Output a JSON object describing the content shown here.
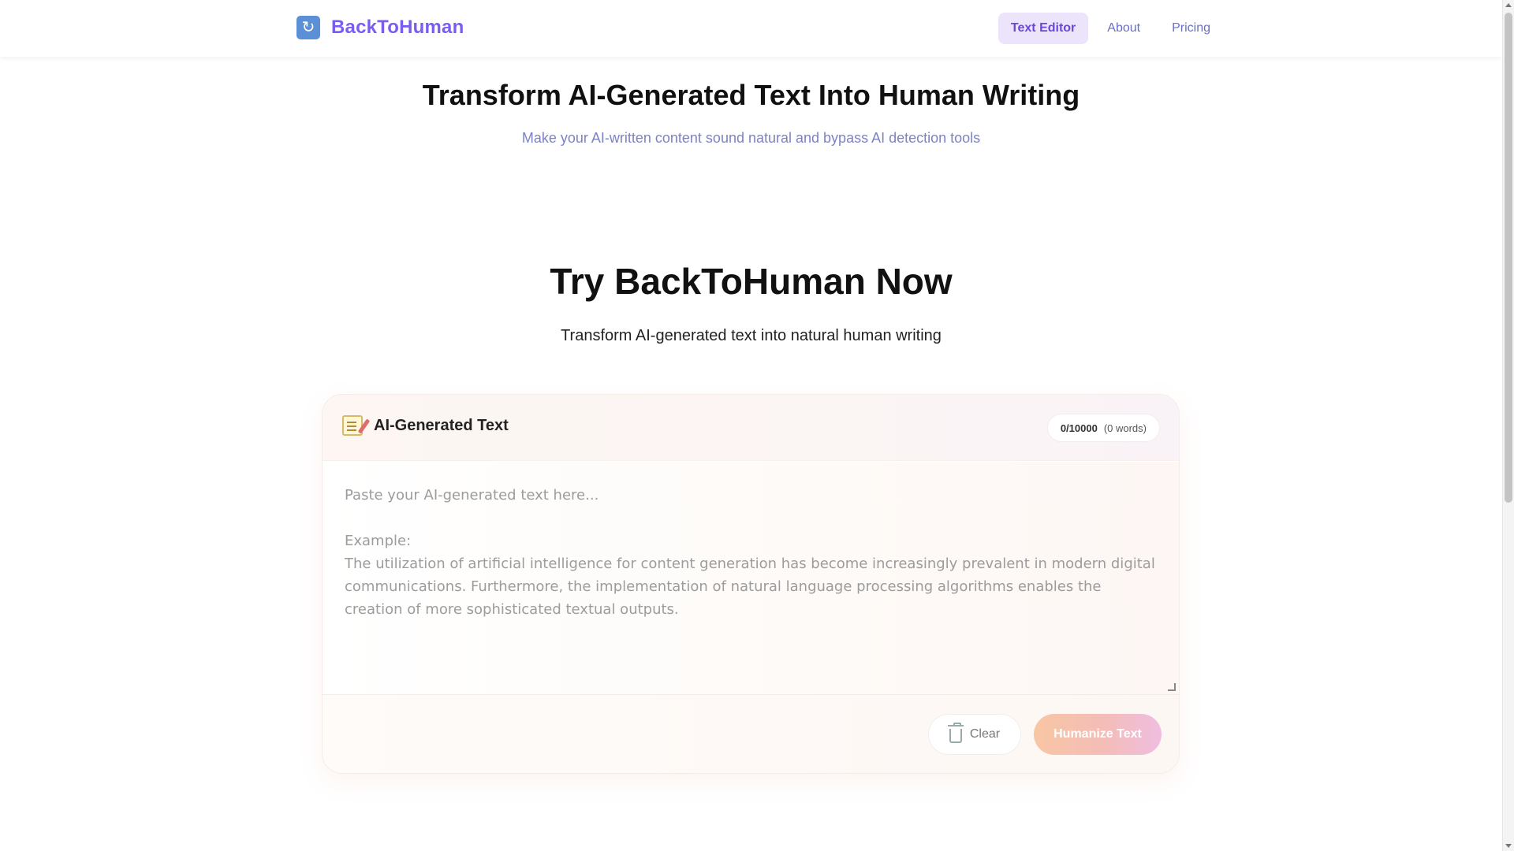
{
  "brand": {
    "name": "BackToHuman",
    "icon": "repeat-arrows-icon",
    "color": "#7b5cf0"
  },
  "nav": {
    "items": [
      {
        "label": "Text Editor",
        "active": true
      },
      {
        "label": "About",
        "active": false
      },
      {
        "label": "Pricing",
        "active": false
      }
    ]
  },
  "hero": {
    "title": "Transform AI-Generated Text Into Human Writing",
    "subtitle": "Make your AI-written content sound natural and bypass AI detection tools"
  },
  "try_section": {
    "title": "Try BackToHuman Now",
    "subtitle": "Transform AI-generated text into natural human writing"
  },
  "editor": {
    "title": "AI-Generated Text",
    "title_icon": "memo-icon",
    "counter": "0/10000",
    "words": "(0 words)",
    "value": "",
    "placeholder": "Paste your AI-generated text here...\n\nExample:\nThe utilization of artificial intelligence for content generation has become increasingly prevalent in modern digital communications. Furthermore, the implementation of natural language processing algorithms enables the creation of more sophisticated textual outputs.",
    "clear_label": "Clear",
    "clear_icon": "trash-icon",
    "humanize_label": "Humanize Text"
  }
}
